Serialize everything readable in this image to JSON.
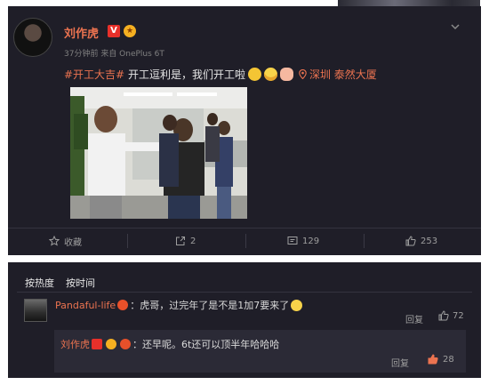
{
  "post": {
    "username": "刘作虎",
    "verified_badge": "V",
    "gold_badge": "★",
    "meta": "37分钟前 来自 OnePlus 6T",
    "hashtag": "#开工大吉#",
    "text": " 开工逗利是，我们开工啦",
    "location": "深圳 泰然大厦"
  },
  "actions": {
    "favorite_label": "收藏",
    "share_count": "2",
    "comment_count": "129",
    "like_count": "253"
  },
  "comments": {
    "sort_hot": "按热度",
    "sort_time": "按时间",
    "items": [
      {
        "username": "Pandaful-life",
        "text": "：虎哥，过完年了是不是1加7要来了",
        "reply_label": "回复",
        "likes": "72"
      }
    ],
    "sub_reply": {
      "username": "刘作虎",
      "text": "：还早呢。6t还可以顶半年哈哈哈",
      "reply_label": "回复",
      "likes": "28"
    }
  },
  "colors": {
    "accent": "#eb7350",
    "background": "#1f1e28",
    "subreply_bg": "#2b2a36"
  }
}
